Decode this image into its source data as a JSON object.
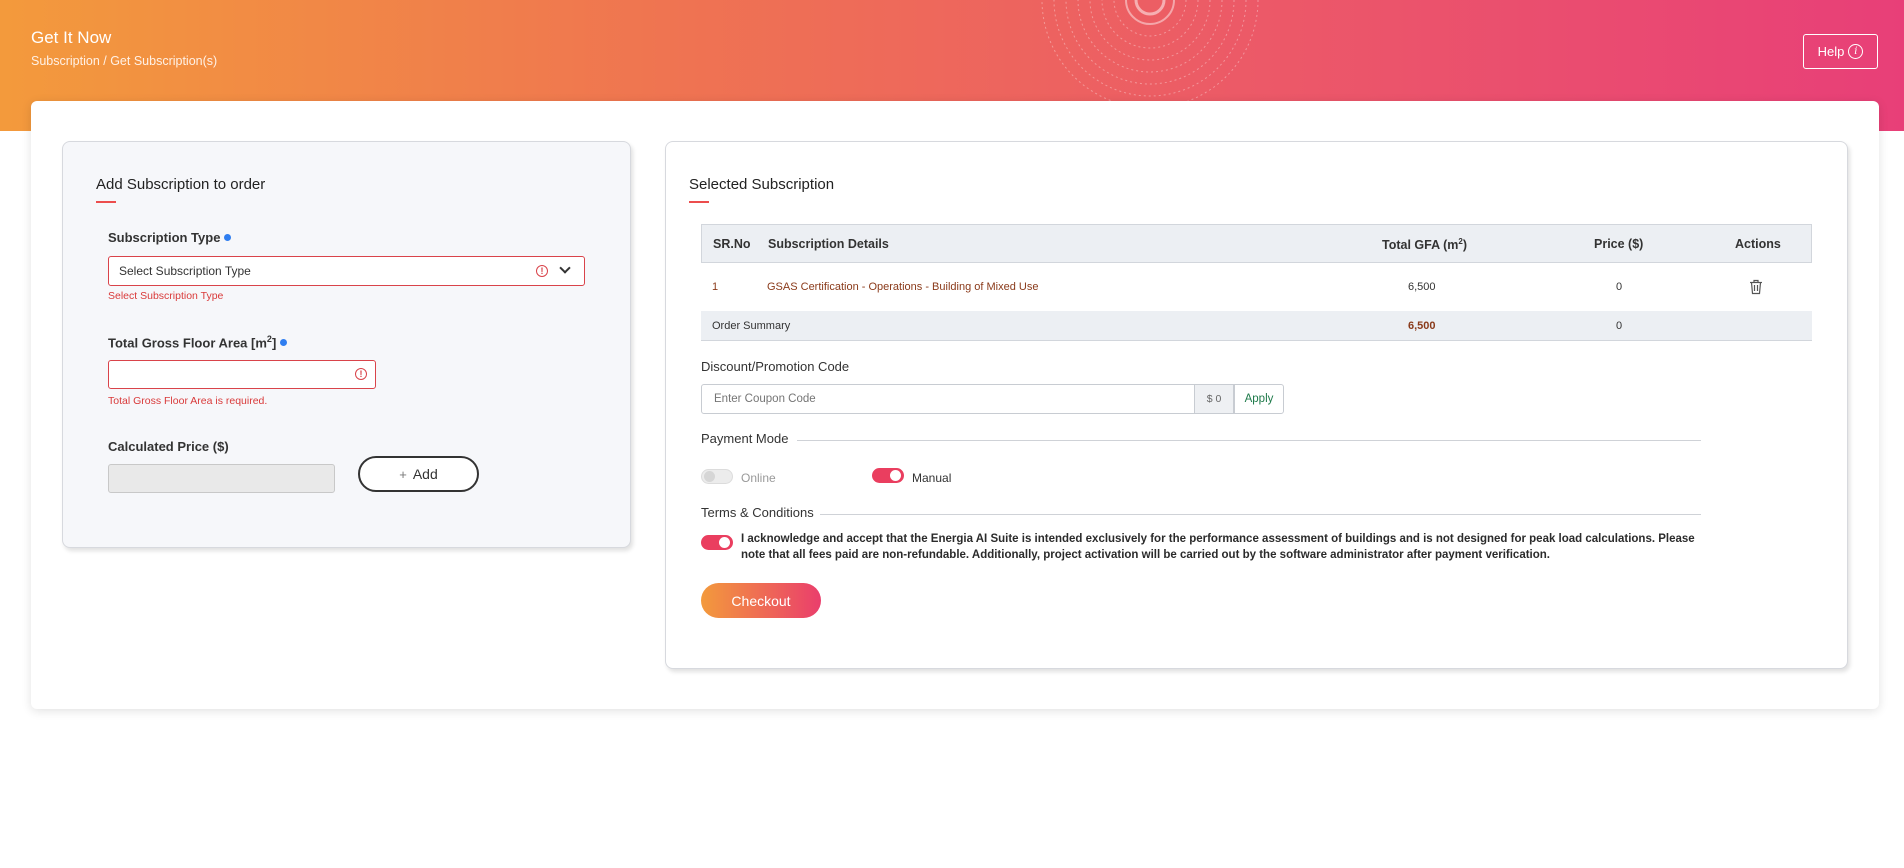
{
  "header": {
    "title": "Get It Now",
    "breadcrumb": "Subscription / Get Subscription(s)",
    "help_label": "Help"
  },
  "colors": {
    "gradient_start": "#f39a3c",
    "gradient_end": "#e83f78",
    "error": "#d9434a",
    "toggle_on": "#ea3e5f",
    "apply_text": "#1e7a4a"
  },
  "add_form": {
    "title": "Add Subscription to order",
    "subscription_type_label": "Subscription Type",
    "subscription_type_placeholder": "Select Subscription Type",
    "subscription_type_error": "Select Subscription Type",
    "gfa_label": "Total Gross Floor Area [m",
    "gfa_label_sup": "2",
    "gfa_label_end": "]",
    "gfa_value": "",
    "gfa_error": "Total Gross Floor Area is required.",
    "price_label": "Calculated Price ($)",
    "price_value": "",
    "add_label": "Add"
  },
  "selected": {
    "title": "Selected Subscription",
    "columns": {
      "sr": "SR.No",
      "details": "Subscription Details",
      "gfa": "Total GFA (m",
      "gfa_sup": "2",
      "gfa_end": ")",
      "price": "Price ($)",
      "actions": "Actions"
    },
    "rows": [
      {
        "sr": "1",
        "details": "GSAS Certification - Operations - Building of Mixed Use",
        "gfa": "6,500",
        "price": "0"
      }
    ],
    "summary": {
      "label": "Order Summary",
      "gfa": "6,500",
      "price": "0"
    }
  },
  "discount": {
    "label": "Discount/Promotion Code",
    "placeholder": "Enter Coupon Code",
    "value_display": "$ 0",
    "apply_label": "Apply"
  },
  "payment": {
    "label": "Payment Mode",
    "online_label": "Online",
    "online_enabled": false,
    "manual_label": "Manual",
    "manual_enabled": true
  },
  "terms": {
    "label": "Terms & Conditions",
    "accepted": true,
    "text": "I acknowledge and accept that the Energia AI Suite is intended exclusively for the performance assessment of buildings and is not designed for peak load calculations. Please note that all fees paid are non-refundable. Additionally, project activation will be carried out by the software administrator after payment verification."
  },
  "checkout_label": "Checkout"
}
